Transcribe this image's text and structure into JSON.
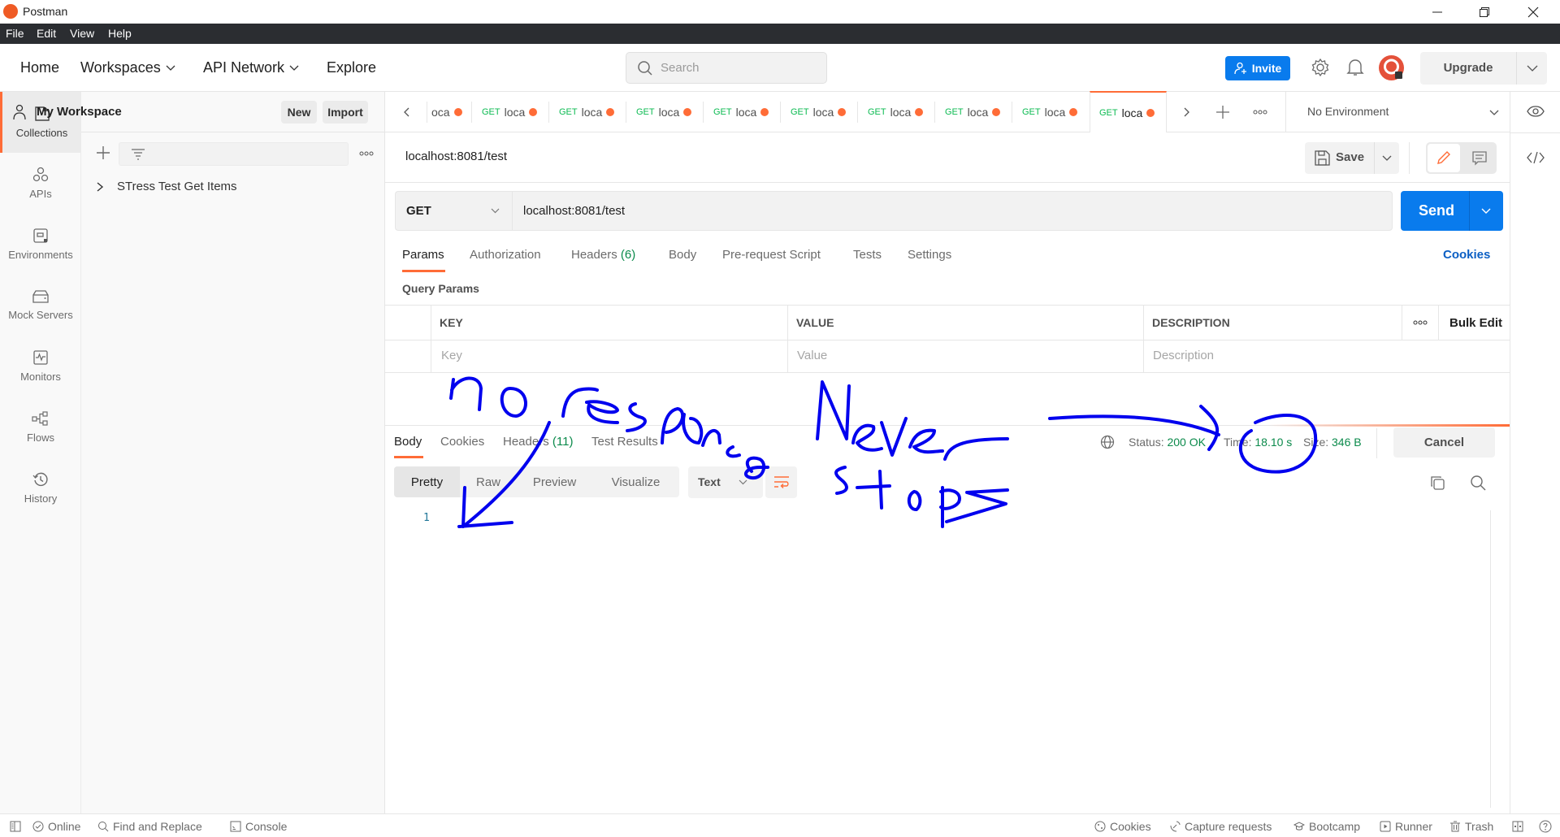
{
  "window": {
    "title": "Postman"
  },
  "menu": [
    "File",
    "Edit",
    "View",
    "Help"
  ],
  "header": {
    "nav": [
      {
        "label": "Home",
        "dropdown": false
      },
      {
        "label": "Workspaces",
        "dropdown": true
      },
      {
        "label": "API Network",
        "dropdown": true
      },
      {
        "label": "Explore",
        "dropdown": false
      }
    ],
    "search_placeholder": "Search",
    "invite_label": "Invite",
    "upgrade_label": "Upgrade"
  },
  "workspace": {
    "name": "My Workspace",
    "new_label": "New",
    "import_label": "Import"
  },
  "rail": [
    {
      "label": "Collections",
      "icon": "collections-icon",
      "active": true
    },
    {
      "label": "APIs",
      "icon": "apis-icon"
    },
    {
      "label": "Environments",
      "icon": "environments-icon"
    },
    {
      "label": "Mock Servers",
      "icon": "mock-servers-icon"
    },
    {
      "label": "Monitors",
      "icon": "monitors-icon"
    },
    {
      "label": "Flows",
      "icon": "flows-icon"
    },
    {
      "label": "History",
      "icon": "history-icon"
    }
  ],
  "collections": [
    {
      "name": "STress Test Get Items"
    }
  ],
  "tabs": {
    "first_partial": "oca",
    "items": [
      {
        "method": "GET",
        "name": "loca"
      },
      {
        "method": "GET",
        "name": "loca"
      },
      {
        "method": "GET",
        "name": "loca"
      },
      {
        "method": "GET",
        "name": "loca"
      },
      {
        "method": "GET",
        "name": "loca"
      },
      {
        "method": "GET",
        "name": "loca"
      },
      {
        "method": "GET",
        "name": "loca"
      },
      {
        "method": "GET",
        "name": "loca"
      },
      {
        "method": "GET",
        "name": "loca",
        "active": true
      }
    ]
  },
  "environment": {
    "selected": "No Environment"
  },
  "request": {
    "title": "localhost:8081/test",
    "save_label": "Save",
    "method": "GET",
    "url": "localhost:8081/test",
    "send_label": "Send",
    "tabs": [
      {
        "label": "Params",
        "active": true
      },
      {
        "label": "Authorization"
      },
      {
        "label": "Headers",
        "count": "(6)"
      },
      {
        "label": "Body"
      },
      {
        "label": "Pre-request Script"
      },
      {
        "label": "Tests"
      },
      {
        "label": "Settings"
      }
    ],
    "cookies_label": "Cookies",
    "query_params_title": "Query Params",
    "params_table": {
      "headers": [
        "KEY",
        "VALUE",
        "DESCRIPTION"
      ],
      "bulk_edit": "Bulk Edit",
      "placeholders": [
        "Key",
        "Value",
        "Description"
      ]
    }
  },
  "response": {
    "tabs": [
      {
        "label": "Body",
        "active": true
      },
      {
        "label": "Cookies"
      },
      {
        "label": "Headers",
        "count": "(11)"
      },
      {
        "label": "Test Results"
      }
    ],
    "status_label": "Status:",
    "status_value": "200 OK",
    "time_label": "Time:",
    "time_value": "18.10 s",
    "size_label": "Size:",
    "size_value": "346 B",
    "cancel_label": "Cancel",
    "view_modes": [
      "Pretty",
      "Raw",
      "Preview",
      "Visualize"
    ],
    "active_view": "Pretty",
    "format": "Text",
    "line_numbers": [
      "1"
    ]
  },
  "annotations": [
    "no response",
    "Never stops"
  ],
  "statusbar": {
    "left": [
      "Online",
      "Find and Replace",
      "Console"
    ],
    "right": [
      "Cookies",
      "Capture requests",
      "Bootcamp",
      "Runner",
      "Trash"
    ]
  },
  "colors": {
    "accent": "#ff6c37",
    "primary": "#097bed",
    "success": "#0b8a4b",
    "annotation": "#0000ee"
  }
}
